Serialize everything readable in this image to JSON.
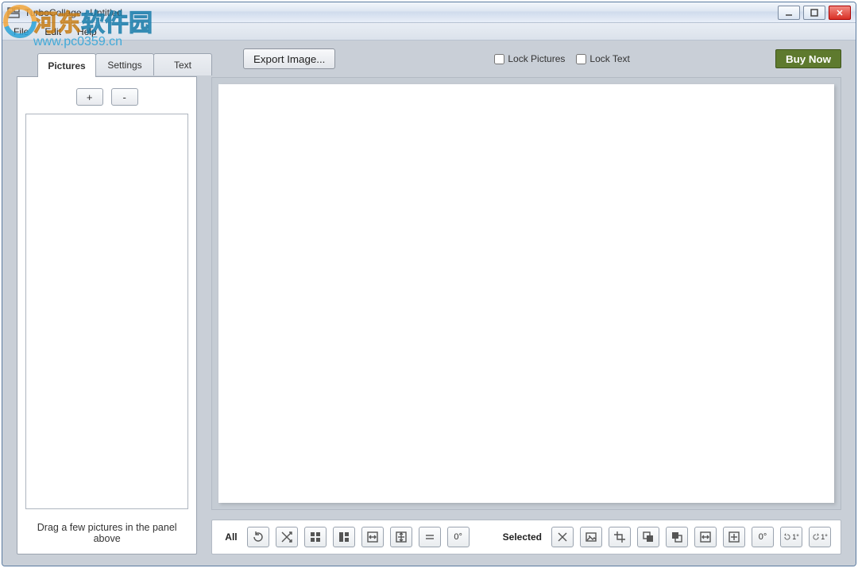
{
  "window": {
    "title": "TurboCollage - Untitled"
  },
  "menubar": {
    "items": [
      "File",
      "Edit",
      "Help"
    ]
  },
  "tabs": {
    "items": [
      {
        "label": "Pictures",
        "active": true
      },
      {
        "label": "Settings",
        "active": false
      },
      {
        "label": "Text",
        "active": false
      }
    ]
  },
  "toolbar": {
    "export_label": "Export Image...",
    "lock_pictures_label": "Lock Pictures",
    "lock_text_label": "Lock Text",
    "lock_pictures_checked": false,
    "lock_text_checked": false,
    "buy_label": "Buy Now"
  },
  "side": {
    "add_label": "+",
    "remove_label": "-",
    "hint": "Drag a few pictures in the panel above"
  },
  "bottom": {
    "all_label": "All",
    "selected_label": "Selected",
    "zero_deg": "0°",
    "one_deg_ccw": "1°",
    "one_deg_cw": "1°",
    "all_buttons": [
      "redo-layout-icon",
      "shuffle-icon",
      "grid-2x2-icon",
      "grid-split-icon",
      "fit-horizontal-icon",
      "fit-all-icon",
      "equal-size-icon",
      "rotate-zero-icon"
    ],
    "selected_buttons": [
      "remove-icon",
      "image-icon",
      "crop-icon",
      "send-back-icon",
      "bring-front-icon",
      "fit-horizontal-icon",
      "fit-all-icon",
      "rotate-zero-icon",
      "rotate-ccw-icon",
      "rotate-cw-icon"
    ]
  },
  "watermark": {
    "line1_prefix": "河东",
    "line1_suffix": "软件园",
    "url": "www.pc0359.cn"
  }
}
